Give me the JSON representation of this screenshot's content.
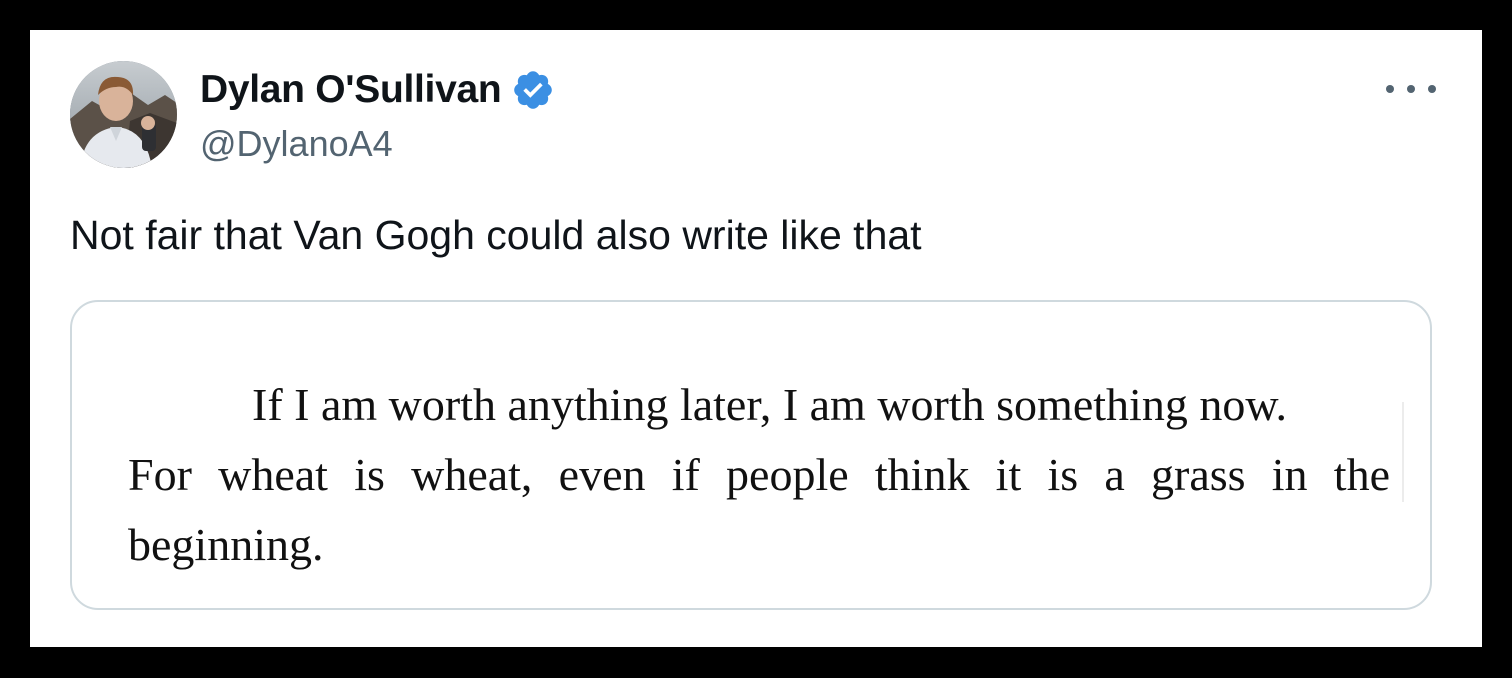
{
  "tweet": {
    "author": {
      "display_name": "Dylan O'Sullivan",
      "handle": "@DylanoA4",
      "verified": true,
      "verified_color": "#3b8fe3",
      "avatar_icon": "profile-photo"
    },
    "more_icon": "more-horizontal-icon",
    "text": "Not fair that Van Gogh could also write like that",
    "media": {
      "quote_lines": [
        "If I am worth anything later, I am worth something now.",
        "For wheat is wheat, even if people think it is a grass in the",
        "beginning."
      ]
    }
  }
}
